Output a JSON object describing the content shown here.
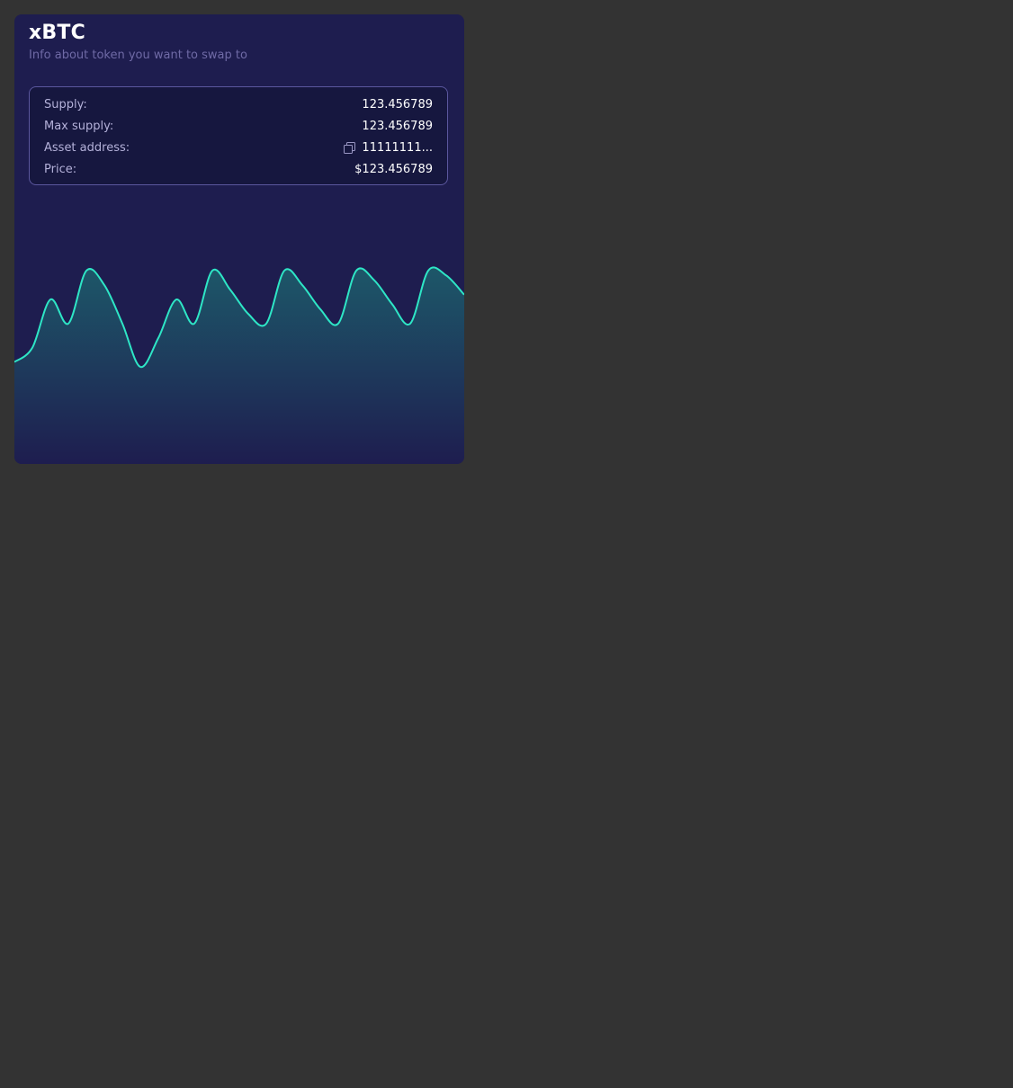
{
  "token": {
    "name": "xBTC",
    "subtitle": "Info about token you want to swap to"
  },
  "info": {
    "supply_label": "Supply:",
    "supply_value": "123.456789",
    "max_supply_label": "Max supply:",
    "max_supply_value": "123.456789",
    "asset_address_label": "Asset address:",
    "asset_address_value": "11111111...",
    "asset_address_icon": "copy-icon",
    "price_label": "Price:",
    "price_value": "$123.456789"
  },
  "colors": {
    "card_bg": "#1e1d4f",
    "line": "#2ee6c6",
    "accent_border": "#5b579e"
  },
  "chart_data": {
    "type": "area",
    "values": [
      0.1,
      0.4,
      1.4,
      0.9,
      2.0,
      1.7,
      0.9,
      0.0,
      0.6,
      1.4,
      0.9,
      2.0,
      1.6,
      1.1,
      0.9,
      2.0,
      1.7,
      1.2,
      0.9,
      2.0,
      1.8,
      1.3,
      0.9,
      2.0,
      1.9,
      1.5
    ]
  }
}
